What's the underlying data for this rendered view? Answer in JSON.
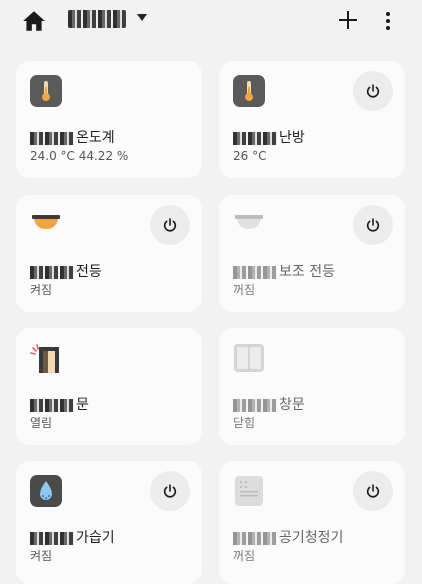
{
  "header": {
    "home_title": "",
    "home_icon": "home-icon",
    "add_icon": "plus-icon",
    "more_icon": "more-vertical-icon"
  },
  "colors": {
    "background": "#f2f2f2",
    "card": "#fbfbfb",
    "power_button": "#ececec",
    "accent_orange": "#f4a341",
    "thermo_bg": "#5a5a5a"
  },
  "devices": [
    {
      "name_suffix": "온도계",
      "status": "24.0 °C 44.22 %",
      "icon": "thermometer-icon",
      "has_power": false,
      "active": true
    },
    {
      "name_suffix": "난방",
      "status": "26 °C",
      "icon": "thermometer-icon",
      "has_power": true,
      "active": true
    },
    {
      "name_suffix": "전등",
      "status": "켜짐",
      "icon": "ceiling-light-on-icon",
      "has_power": true,
      "active": true
    },
    {
      "name_suffix": "보조 전등",
      "status": "꺼짐",
      "icon": "ceiling-light-off-icon",
      "has_power": true,
      "active": false
    },
    {
      "name_suffix": "문",
      "status": "열림",
      "icon": "door-open-icon",
      "has_power": false,
      "active": true
    },
    {
      "name_suffix": "창문",
      "status": "닫힘",
      "icon": "window-closed-icon",
      "has_power": false,
      "active": false
    },
    {
      "name_suffix": "가습기",
      "status": "켜짐",
      "icon": "humidifier-icon",
      "has_power": true,
      "active": true
    },
    {
      "name_suffix": "공기청정기",
      "status": "꺼짐",
      "icon": "air-purifier-icon",
      "has_power": true,
      "active": false
    }
  ]
}
